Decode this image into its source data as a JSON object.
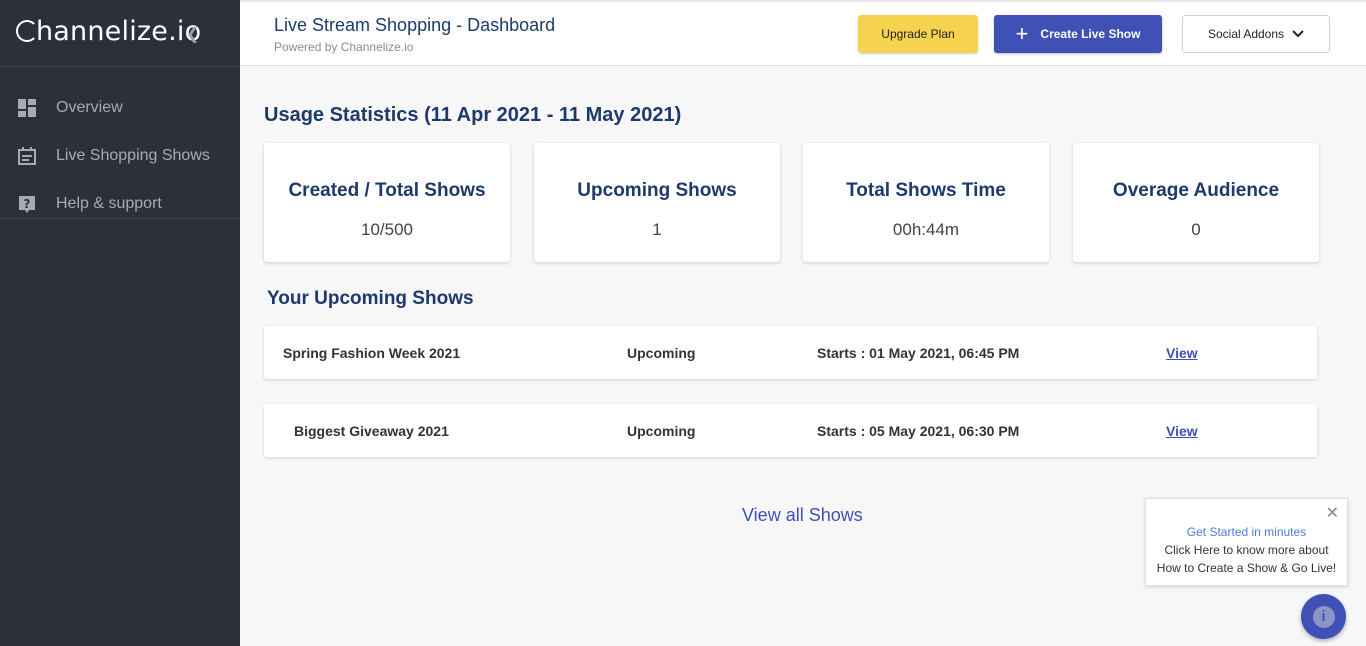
{
  "brand": {
    "logo_text": "hannelize.io",
    "logo_initial": "C"
  },
  "sidebar": {
    "items": [
      {
        "label": "Overview",
        "icon": "dashboard-icon"
      },
      {
        "label": "Live Shopping Shows",
        "icon": "calendar-icon"
      },
      {
        "label": "Help & support",
        "icon": "help-icon"
      }
    ]
  },
  "header": {
    "title": "Live Stream Shopping - Dashboard",
    "subtitle": "Powered by Channelize.io",
    "upgrade_label": "Upgrade Plan",
    "create_label": "Create Live Show",
    "social_label": "Social Addons"
  },
  "stats": {
    "title": "Usage Statistics (11 Apr 2021 - 11 May 2021)",
    "cards": [
      {
        "label": "Created / Total Shows",
        "value": "10/500"
      },
      {
        "label": "Upcoming Shows",
        "value": "1"
      },
      {
        "label": "Total Shows Time",
        "value": "00h:44m"
      },
      {
        "label": "Overage Audience",
        "value": "0"
      }
    ]
  },
  "upcoming": {
    "title": "Your Upcoming Shows",
    "shows": [
      {
        "name": "Spring Fashion Week 2021",
        "status": "Upcoming",
        "starts": "Starts : 01 May 2021, 06:45 PM",
        "action": "View"
      },
      {
        "name": "Biggest Giveaway 2021",
        "status": "Upcoming",
        "starts": "Starts : 05 May 2021, 06:30 PM",
        "action": "View"
      }
    ],
    "view_all": "View all Shows"
  },
  "popup": {
    "line1": "Get Started in minutes",
    "line2": "Click Here to know more about",
    "line3": "How to Create a Show & Go Live!",
    "close_icon": "close-icon"
  },
  "colors": {
    "sidebar_bg": "#2c303b",
    "primary": "#3f51b5",
    "upgrade": "#f6d34f",
    "heading": "#1d3a6c"
  }
}
